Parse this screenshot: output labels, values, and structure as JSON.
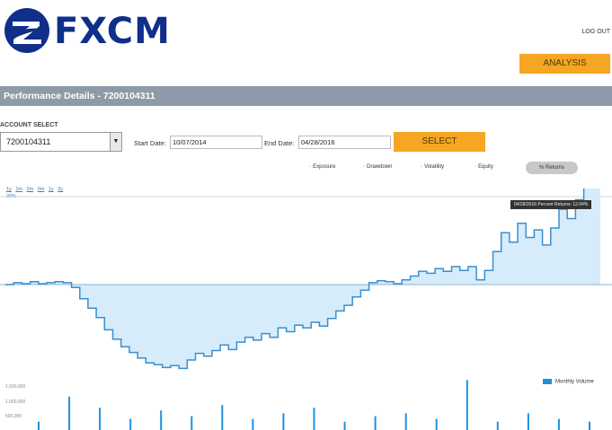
{
  "brand": {
    "name": "FXCM",
    "color": "#0f2f8a"
  },
  "header": {
    "logout_label": "LOG OUT",
    "analysis_label": "ANALYSIS"
  },
  "title_bar": {
    "text": "Performance Details - 7200104311"
  },
  "account": {
    "label": "ACCOUNT SELECT",
    "selected": "7200104311"
  },
  "dates": {
    "start_label": "Start Date:",
    "start_value": "10/07/2014",
    "end_label": "End Date:",
    "end_value": "04/28/2016"
  },
  "select_label": "SELECT",
  "series_toggles": [
    {
      "label": "Exposure"
    },
    {
      "label": "Drawdown"
    },
    {
      "label": "Volatility"
    },
    {
      "label": "Equity"
    }
  ],
  "active_toggle": "% Returns",
  "zoom_links": [
    "1y",
    "1m",
    "3m",
    "6m",
    "1y",
    "3y"
  ],
  "zoom_sub": "20%",
  "tooltip": "04/28/2016 Percent Returns: 12.04%",
  "volume_legend": "Monthly Volume",
  "volume_axis": [
    "1,500,000",
    "1,000,000",
    "500,000"
  ],
  "colors": {
    "accent": "#f5a623",
    "title_bar": "#8e9aa8",
    "line": "#3a8fd0",
    "fill": "#d6ecfa",
    "volume": "#1e90e0"
  },
  "chart_data": {
    "type": "area",
    "baseline": 0,
    "values": [
      0,
      0.2,
      0.1,
      0.3,
      0.1,
      0.2,
      0.3,
      0.2,
      -0.3,
      -1.5,
      -2.5,
      -3.5,
      -4.8,
      -5.8,
      -6.6,
      -7.2,
      -7.8,
      -8.3,
      -8.5,
      -8.8,
      -8.6,
      -8.9,
      -8.0,
      -7.3,
      -7.6,
      -7.0,
      -6.4,
      -6.9,
      -6.1,
      -5.6,
      -5.9,
      -5.2,
      -5.6,
      -4.6,
      -5.0,
      -4.3,
      -4.6,
      -4.0,
      -4.4,
      -3.6,
      -2.8,
      -2.2,
      -1.3,
      -0.6,
      0.2,
      0.4,
      0.3,
      0.1,
      0.5,
      0.9,
      1.4,
      1.2,
      1.7,
      1.4,
      1.9,
      1.5,
      1.9,
      0.5,
      1.5,
      3.5,
      5.5,
      4.5,
      6.5,
      5.0,
      5.8,
      4.2,
      6.0,
      8.0,
      7.0,
      9.0,
      10.5,
      11.5,
      12.04
    ],
    "volume": [
      0.3,
      1.2,
      0.8,
      0.4,
      0.7,
      0.5,
      0.9,
      0.4,
      0.6,
      0.8,
      0.3,
      0.5,
      0.6,
      0.4,
      1.8,
      0.3,
      0.6,
      0.4,
      0.3
    ]
  }
}
